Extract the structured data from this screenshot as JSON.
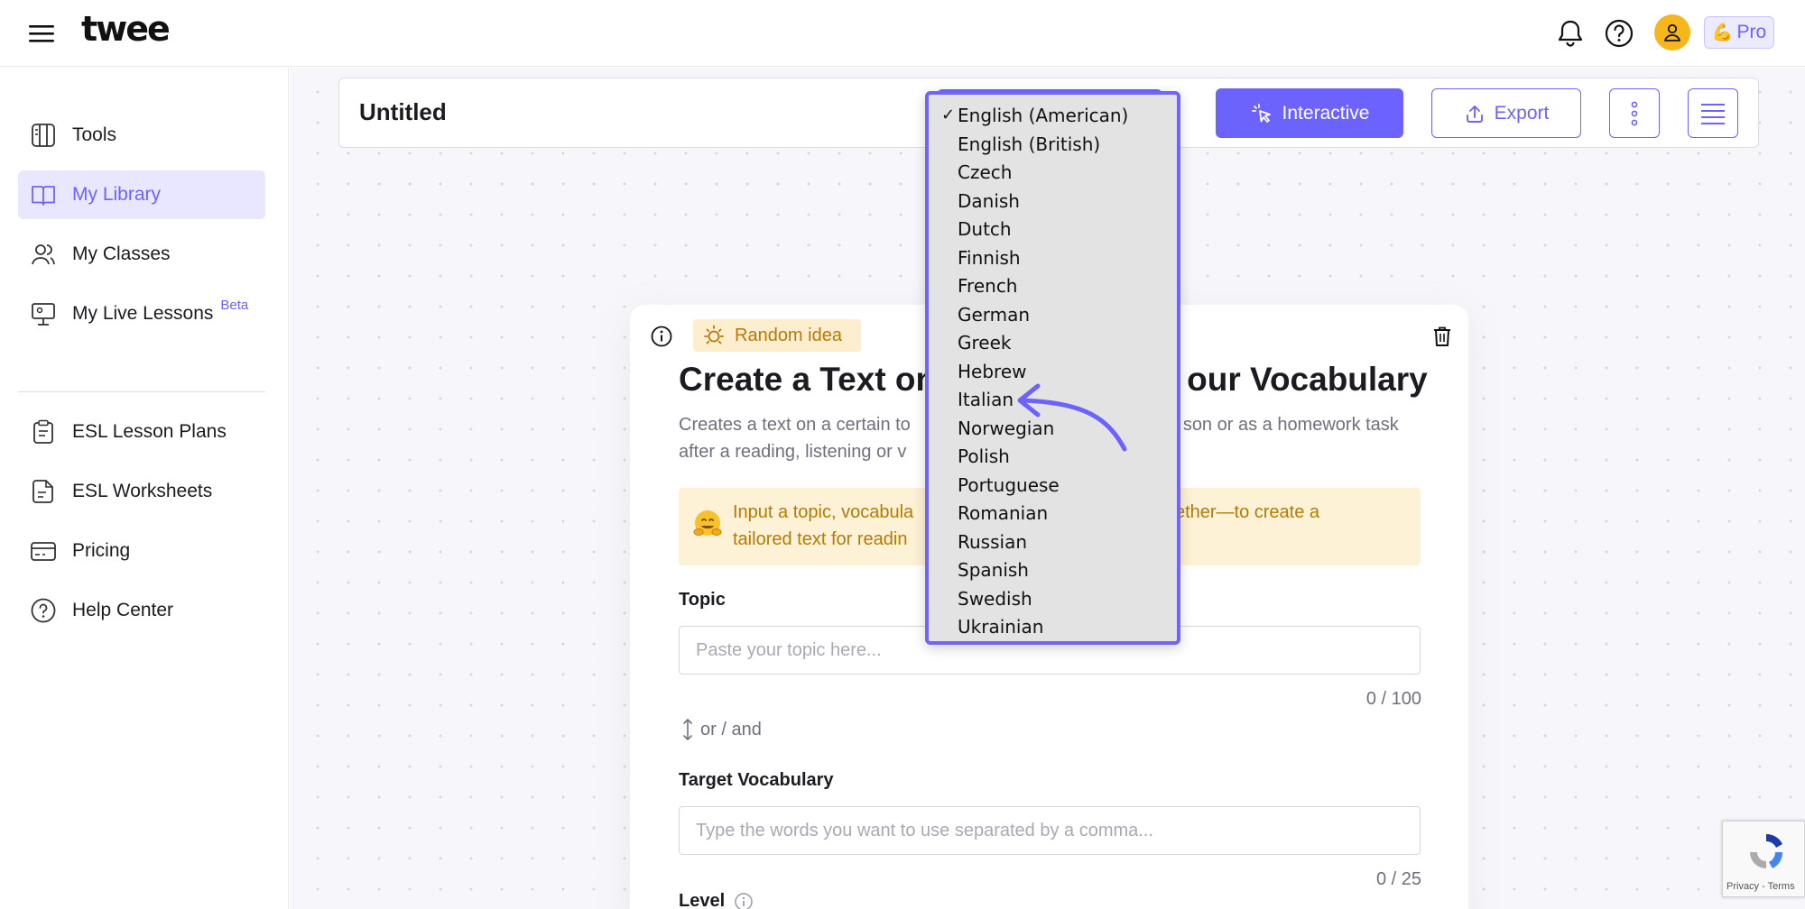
{
  "app": {
    "logo_text": "twee"
  },
  "topbar": {
    "pro_label": "Pro",
    "icons": [
      "menu-icon",
      "bell-icon",
      "help-icon",
      "user-icon"
    ]
  },
  "sidebar": {
    "items": [
      {
        "label": "Tools",
        "icon": "tools-icon",
        "active": false
      },
      {
        "label": "My Library",
        "icon": "book-icon",
        "active": true
      },
      {
        "label": "My Classes",
        "icon": "users-icon",
        "active": false
      },
      {
        "label": "My Live Lessons",
        "icon": "presentation-icon",
        "active": false,
        "badge": "Beta"
      },
      {
        "label": "ESL Lesson Plans",
        "icon": "clipboard-icon",
        "active": false
      },
      {
        "label": "ESL Worksheets",
        "icon": "worksheet-icon",
        "active": false
      },
      {
        "label": "Pricing",
        "icon": "card-icon",
        "active": false
      },
      {
        "label": "Help Center",
        "icon": "help-icon",
        "active": false
      }
    ]
  },
  "document": {
    "title": "Untitled",
    "interactive_label": "Interactive",
    "export_label": "Export"
  },
  "language_dropdown": {
    "selected": "English (American)",
    "options": [
      "English (American)",
      "English (British)",
      "Czech",
      "Danish",
      "Dutch",
      "Finnish",
      "French",
      "German",
      "Greek",
      "Hebrew",
      "Italian",
      "Norwegian",
      "Polish",
      "Portuguese",
      "Romanian",
      "Russian",
      "Spanish",
      "Swedish",
      "Ukrainian"
    ]
  },
  "card": {
    "random_idea_label": "Random idea",
    "heading": "Create a Text on                          our Vocabulary",
    "heading_left": "Create a Text on",
    "heading_right": "our Vocabulary",
    "description_line1_left": "Creates a text on a certain to",
    "description_line1_right": "son or as a homework task",
    "description_line2": "after a reading, listening or v",
    "hint_line1_left": "Input a topic, vocabula",
    "hint_line1_right": "together—to create a",
    "hint_line2": "tailored text for readin",
    "topic": {
      "label": "Topic",
      "placeholder": "Paste your topic here...",
      "value": "",
      "counter": "0 / 100"
    },
    "or_and": "or / and",
    "vocabulary": {
      "label": "Target Vocabulary",
      "placeholder": "Type the words you want to use separated by a comma...",
      "value": "",
      "counter": "0 / 25"
    },
    "level_label": "Level"
  },
  "recaptcha": {
    "text": "Privacy - Terms"
  },
  "colors": {
    "accent": "#6c63ff",
    "hint_bg": "#fdf1d6",
    "hint_text": "#b57a06"
  }
}
